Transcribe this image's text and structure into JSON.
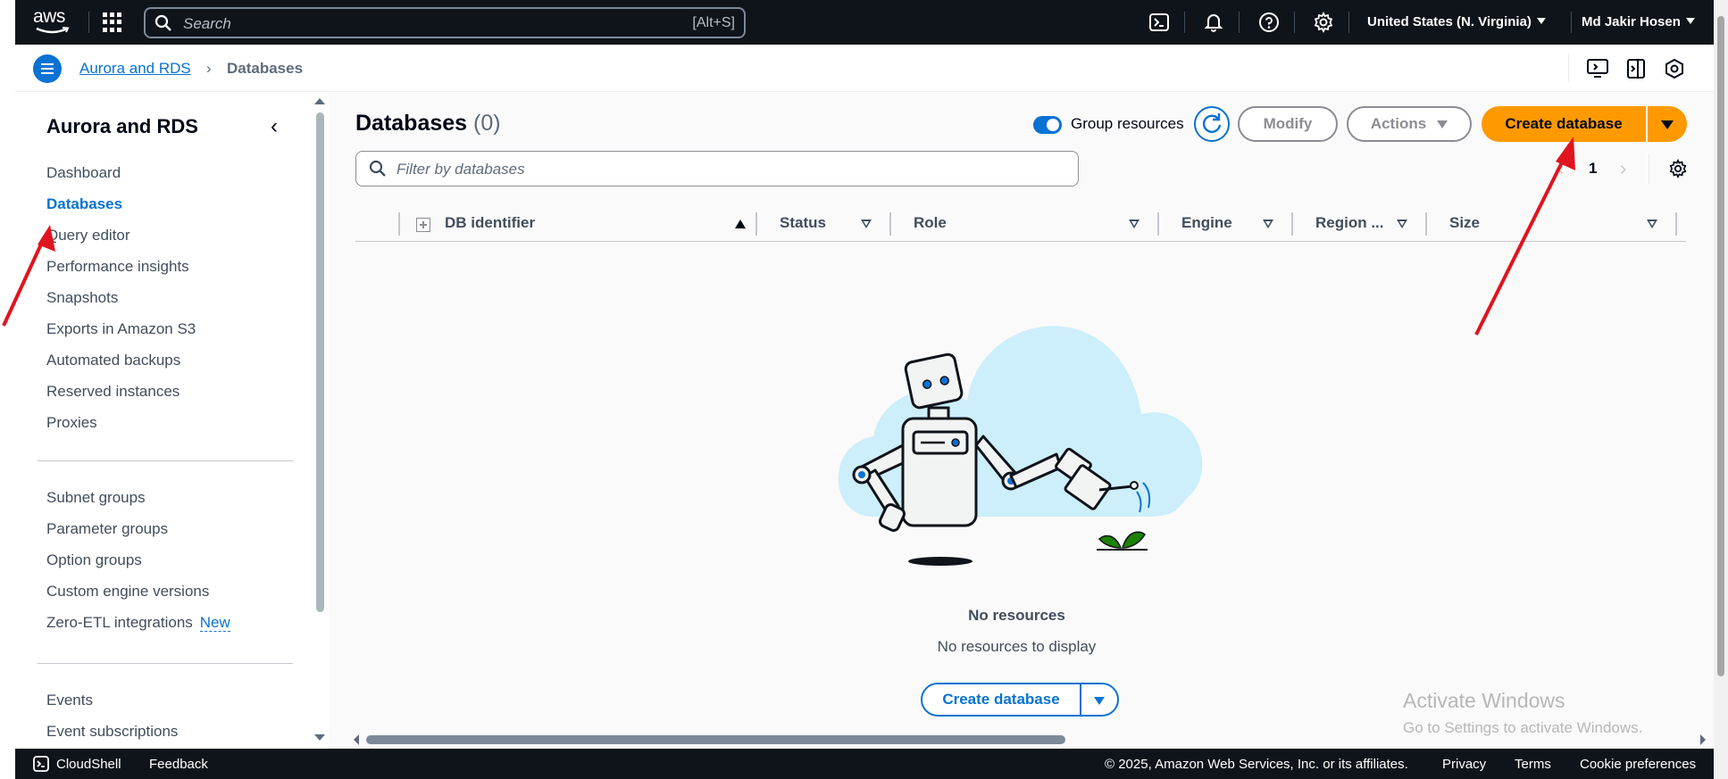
{
  "topbar": {
    "logo_text": "aws",
    "search_placeholder": "Search",
    "search_shortcut": "[Alt+S]",
    "region": "United States (N. Virginia)",
    "user": "Md Jakir Hosen"
  },
  "breadcrumb": {
    "parent": "Aurora and RDS",
    "current": "Databases"
  },
  "sidenav": {
    "title": "Aurora and RDS",
    "items": [
      "Dashboard",
      "Databases",
      "Query editor",
      "Performance insights",
      "Snapshots",
      "Exports in Amazon S3",
      "Automated backups",
      "Reserved instances",
      "Proxies"
    ],
    "items2": [
      "Subnet groups",
      "Parameter groups",
      "Option groups",
      "Custom engine versions",
      "Zero-ETL integrations"
    ],
    "new_badge": "New",
    "items3": [
      "Events",
      "Event subscriptions"
    ],
    "active": "Databases"
  },
  "main": {
    "title": "Databases",
    "count": "(0)",
    "group_resources_label": "Group resources",
    "group_resources_on": true,
    "modify_label": "Modify",
    "actions_label": "Actions",
    "create_label": "Create database",
    "filter_placeholder": "Filter by databases",
    "page_number": "1",
    "columns": [
      "DB identifier",
      "Status",
      "Role",
      "Engine",
      "Region ...",
      "Size"
    ],
    "empty_title": "No resources",
    "empty_desc": "No resources to display",
    "empty_create_label": "Create database"
  },
  "watermark": {
    "line1": "Activate Windows",
    "line2": "Go to Settings to activate Windows."
  },
  "footer": {
    "cloudshell": "CloudShell",
    "feedback": "Feedback",
    "copyright": "© 2025, Amazon Web Services, Inc. or its affiliates.",
    "privacy": "Privacy",
    "terms": "Terms",
    "cookie": "Cookie preferences"
  },
  "colors": {
    "topbar_bg": "#0f141a",
    "link_blue": "#0972d3",
    "primary_orange": "#ff9900",
    "annotation_red": "#e0141e"
  }
}
